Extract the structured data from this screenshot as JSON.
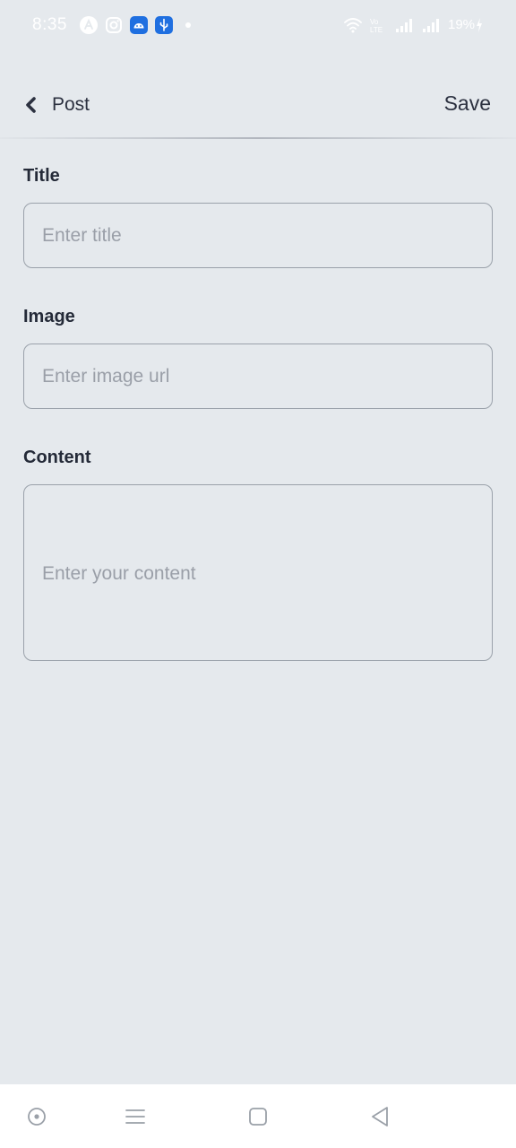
{
  "status_bar": {
    "time": "8:35",
    "battery": "19%",
    "icons": [
      "assistant-icon",
      "instagram-icon",
      "android-icon",
      "usb-icon",
      "notification-dot-icon",
      "wifi-icon",
      "volte-icon",
      "signal-icon",
      "signal-icon",
      "charging-icon"
    ],
    "text_color": "#ffffff"
  },
  "header": {
    "title": "Post",
    "save_label": "Save"
  },
  "form": {
    "title": {
      "label": "Title",
      "placeholder": "Enter title",
      "value": ""
    },
    "image": {
      "label": "Image",
      "placeholder": "Enter image url",
      "value": ""
    },
    "content": {
      "label": "Content",
      "placeholder": "Enter your content",
      "value": ""
    }
  },
  "nav_bar": {
    "buttons": [
      "assistant-button",
      "recents-button",
      "home-button",
      "back-button"
    ]
  },
  "colors": {
    "background": "#e5e9ed",
    "text": "#2c3140",
    "placeholder": "#9a9fa8",
    "field_border": "#9aa1aa"
  }
}
